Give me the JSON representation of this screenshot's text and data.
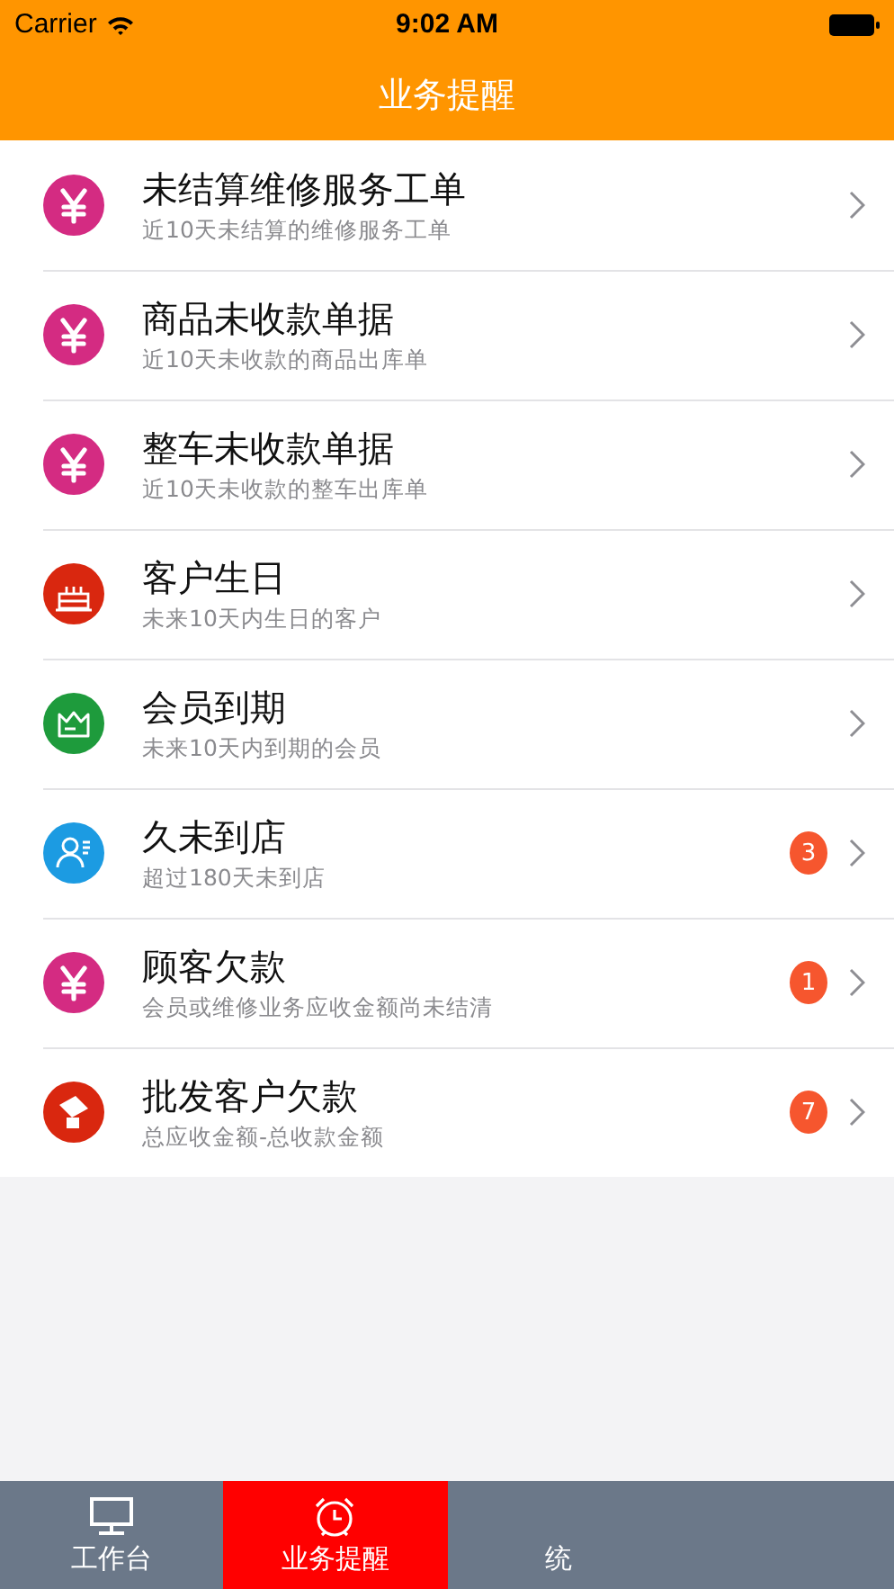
{
  "status_bar": {
    "carrier": "Carrier",
    "time": "9:02 AM"
  },
  "nav_bar": {
    "title": "业务提醒"
  },
  "reminders": [
    {
      "kind": "yen",
      "color": "#d42b82",
      "title": "未结算维修服务工单",
      "subtitle": "近10天未结算的维修服务工单"
    },
    {
      "kind": "yen",
      "color": "#d42b82",
      "title": "商品未收款单据",
      "subtitle": "近10天未收款的商品出库单"
    },
    {
      "kind": "yen",
      "color": "#d42b82",
      "title": "整车未收款单据",
      "subtitle": "近10天未收款的整车出库单"
    },
    {
      "kind": "cake",
      "color": "#d9270f",
      "title": "客户生日",
      "subtitle": "未来10天内生日的客户"
    },
    {
      "kind": "crown",
      "color": "#1e9b3c",
      "title": "会员到期",
      "subtitle": "未来10天内到期的会员"
    },
    {
      "kind": "person",
      "color": "#1c9be2",
      "title": "久未到店",
      "subtitle": "超过180天未到店",
      "badge": "3"
    },
    {
      "kind": "yen",
      "color": "#d42b82",
      "title": "顾客欠款",
      "subtitle": "会员或维修业务应收金额尚未结清",
      "badge": "1"
    },
    {
      "kind": "hand",
      "color": "#d9270f",
      "title": "批发客户欠款",
      "subtitle": "总应收金额-总收款金额",
      "badge": "7"
    }
  ],
  "tab_bar": [
    {
      "kind": "monitor",
      "label": "工作台",
      "selected": false
    },
    {
      "kind": "alarm",
      "label": "业务提醒",
      "selected": true
    },
    {
      "kind": "hidden",
      "label": "统",
      "selected": false
    }
  ]
}
